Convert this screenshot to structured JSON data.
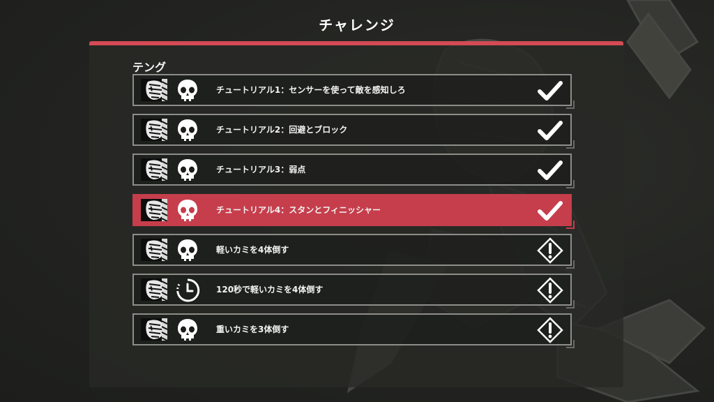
{
  "screen_title": "チャレンジ",
  "section": "テング",
  "colors": {
    "accent": "#d44a55",
    "active_row": "#c63e4c",
    "row_border": "#8d8e8a",
    "panel": "#282926",
    "background": "#222320"
  },
  "challenges": [
    {
      "label": "チュートリアル1：センサーを使って敵を感知しろ",
      "type_icon": "skull-icon",
      "status_icon": "checkmark-icon",
      "completed": true,
      "active": false
    },
    {
      "label": "チュートリアル2：回避とブロック",
      "type_icon": "skull-icon",
      "status_icon": "checkmark-icon",
      "completed": true,
      "active": false
    },
    {
      "label": "チュートリアル3：弱点",
      "type_icon": "skull-icon",
      "status_icon": "checkmark-icon",
      "completed": true,
      "active": false
    },
    {
      "label": "チュートリアル4：スタンとフィニッシャー",
      "type_icon": "skull-icon",
      "status_icon": "checkmark-icon",
      "completed": true,
      "active": true
    },
    {
      "label": "軽いカミを4体倒す",
      "type_icon": "skull-icon",
      "status_icon": "warning-diamond-icon",
      "completed": false,
      "active": false
    },
    {
      "label": "120秒で軽いカミを4体倒す",
      "type_icon": "timer-icon",
      "status_icon": "warning-diamond-icon",
      "completed": false,
      "active": false
    },
    {
      "label": "重いカミを3体倒す",
      "type_icon": "skull-icon",
      "status_icon": "warning-diamond-icon",
      "completed": false,
      "active": false
    }
  ]
}
